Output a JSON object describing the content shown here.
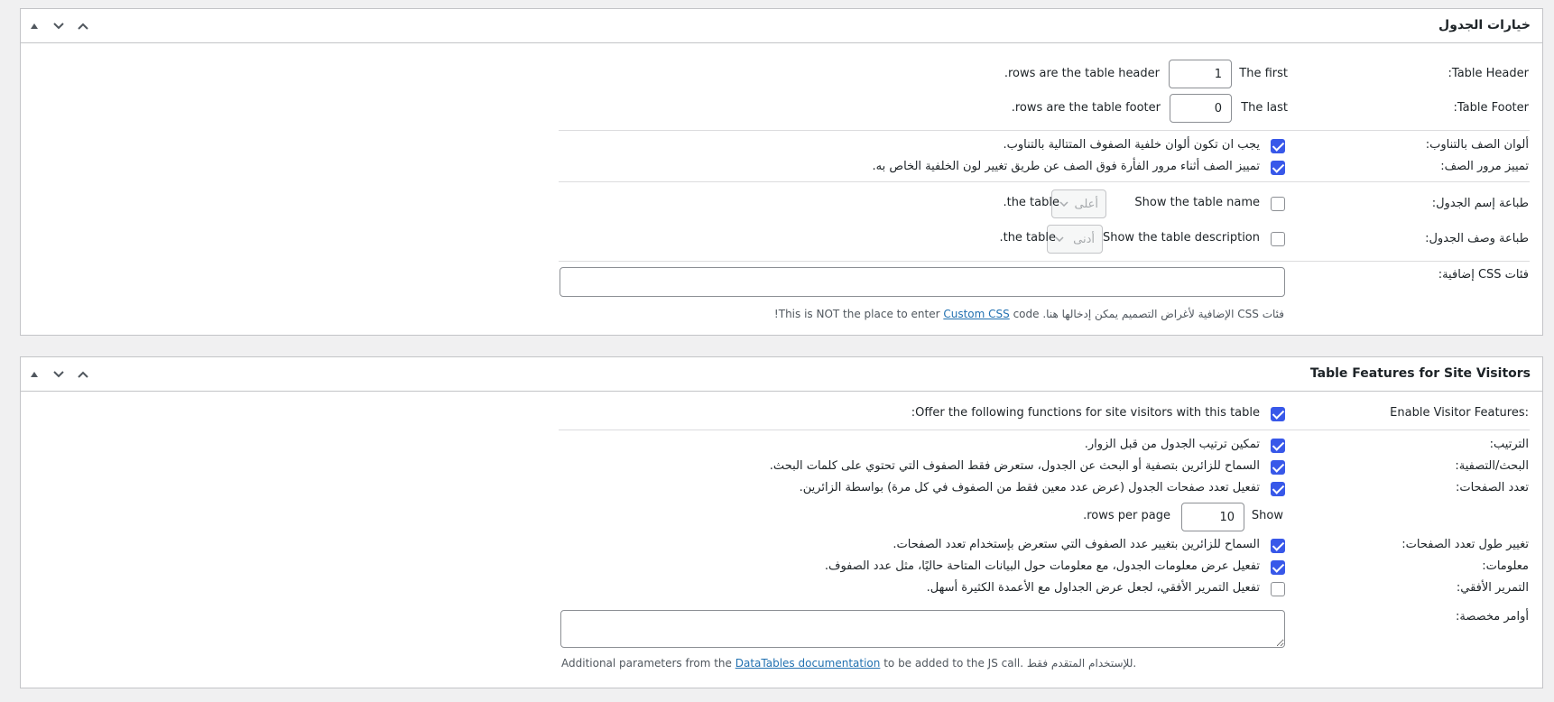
{
  "panel1": {
    "title": "خيارات الجدول",
    "table_header": {
      "label": "Table Header:",
      "prefix": "The first",
      "value": "1",
      "suffix": "rows are the table header."
    },
    "table_footer": {
      "label": "Table Footer:",
      "prefix": "The last",
      "value": "0",
      "suffix": "rows are the table footer."
    },
    "alt_colors": {
      "label": "ألوان الصف بالتناوب:",
      "text": "يجب ان تكون ألوان خلفية الصفوف المتتالية بالتناوب.",
      "checked": true
    },
    "row_hover": {
      "label": "تمييز مرور الصف:",
      "text": "تمييز الصف أثناء مرور الفأرة فوق الصف عن طريق تغيير لون الخلفية الخاص به.",
      "checked": true
    },
    "print_name": {
      "label": "طباعة إسم الجدول:",
      "text": "Show the table name",
      "select": "أعلى",
      "suffix": "the table.",
      "checked": false
    },
    "print_desc": {
      "label": "طباعة وصف الجدول:",
      "text": "Show the table description",
      "select": "أدنى",
      "suffix": "the table.",
      "checked": false
    },
    "css_classes": {
      "label": "فئات CSS إضافية:",
      "value": "",
      "desc_before": "فئات CSS الإضافية لأغراض التصميم يمكن إدخالها هنا. This is NOT the place to enter",
      "desc_link": "Custom CSS",
      "desc_after": "code!"
    }
  },
  "panel2": {
    "title": "Table Features for Site Visitors",
    "enable": {
      "label": "Enable Visitor Features:",
      "text": "Offer the following functions for site visitors with this table:",
      "checked": true
    },
    "sorting": {
      "label": "الترتيب:",
      "text": "تمكين ترتيب الجدول من قبل الزوار.",
      "checked": true
    },
    "filtering": {
      "label": "البحث/التصفية:",
      "text": "السماح للزائرين بتصفية أو البحث عن الجدول، ستعرض فقط الصفوف التي تحتوي على كلمات البحث.",
      "checked": true
    },
    "pagination": {
      "label": "تعدد الصفحات:",
      "text": "تفعيل تعدد صفحات الجدول (عرض عدد معين فقط من الصفوف في كل مرة) بواسطة الزائرين.",
      "checked": true
    },
    "rows_per_page": {
      "prefix": "Show",
      "value": "10",
      "suffix": "rows per page."
    },
    "length_change": {
      "label": "تغيير طول تعدد الصفحات:",
      "text": "السماح للزائرين بتغيير عدد الصفوف التي ستعرض بإستخدام تعدد الصفحات.",
      "checked": true
    },
    "info": {
      "label": "معلومات:",
      "text": "تفعيل عرض معلومات الجدول، مع معلومات حول البيانات المتاحة حاليًا، مثل عدد الصفوف.",
      "checked": true
    },
    "h_scroll": {
      "label": "التمرير الأفقي:",
      "text": "تفعيل التمرير الأفقي، لجعل عرض الجداول مع الأعمدة الكثيرة أسهل.",
      "checked": false
    },
    "custom_commands": {
      "label": "أوامر مخصصة:",
      "value": "",
      "desc_before": "Additional parameters from the",
      "desc_link": "DataTables documentation",
      "desc_after": "to be added to the JS call. للإستخدام المتقدم فقط."
    }
  },
  "colors": {
    "accent": "#3858e9",
    "link": "#2271b1",
    "border": "#c3c4c7"
  },
  "icons": [
    "triangle-up-icon",
    "chevron-down-icon",
    "chevron-up-icon",
    "checkmark-icon",
    "select-arrow-icon"
  ]
}
